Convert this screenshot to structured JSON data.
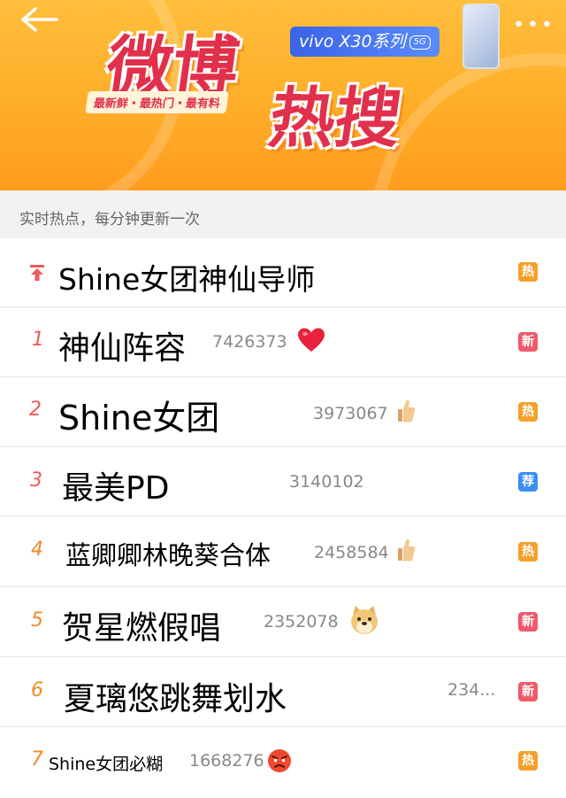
{
  "banner": {
    "title_part1": "微博",
    "title_part2": "热搜",
    "slogan": "最新鲜・最热门・最有料",
    "sponsor": "vivo X30系列",
    "sponsor_tag": "5G",
    "more": "•••"
  },
  "subheader": "实时热点，每分钟更新一次",
  "colors": {
    "hot": "#f5a02a",
    "new": "#ef5a6a",
    "recommend": "#3a8ef0",
    "rank_top3": "#f15a5a",
    "rank_other": "#f08a26",
    "pin": "#f15a5a"
  },
  "items": [
    {
      "rank": "",
      "rank_icon": "pin-icon",
      "keyword": "Shine女团神仙导师",
      "count": "",
      "emoji": "",
      "badge": "热",
      "badge_type": "hot"
    },
    {
      "rank": "1",
      "keyword": "神仙阵容",
      "count": "7426373",
      "emoji": "heart-icon",
      "badge": "新",
      "badge_type": "new"
    },
    {
      "rank": "2",
      "keyword": "Shine女团",
      "count": "3973067",
      "emoji": "thumbs-up-icon",
      "badge": "热",
      "badge_type": "hot"
    },
    {
      "rank": "3",
      "keyword": "最美PD",
      "count": "3140102",
      "emoji": "",
      "badge": "荐",
      "badge_type": "recommend"
    },
    {
      "rank": "4",
      "keyword": "蓝卿卿林晚葵合体",
      "count": "2458584",
      "emoji": "thumbs-up-icon",
      "badge": "热",
      "badge_type": "hot"
    },
    {
      "rank": "5",
      "keyword": "贺星燃假唱",
      "count": "2352078",
      "emoji": "doge-icon",
      "badge": "新",
      "badge_type": "new"
    },
    {
      "rank": "6",
      "keyword": "夏璃悠跳舞划水",
      "count": "234...",
      "emoji": "",
      "badge": "新",
      "badge_type": "new"
    },
    {
      "rank": "7",
      "keyword": "Shine女团必糊",
      "count": "1668276",
      "emoji": "angry-icon",
      "badge": "热",
      "badge_type": "hot"
    }
  ]
}
